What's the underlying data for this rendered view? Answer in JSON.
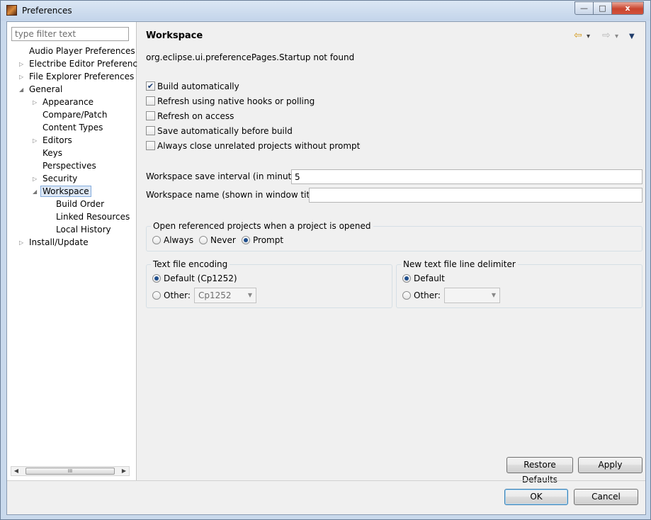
{
  "window": {
    "title": "Preferences",
    "buttons": {
      "minimize": "—",
      "maximize": "□",
      "close": "x"
    }
  },
  "filter": {
    "placeholder": "type filter text"
  },
  "tree": [
    {
      "label": "Audio Player Preferences",
      "level": 1,
      "twisty": ""
    },
    {
      "label": "Electribe Editor Preferences",
      "level": 1,
      "twisty": "collapsed"
    },
    {
      "label": "File Explorer Preferences",
      "level": 1,
      "twisty": "collapsed"
    },
    {
      "label": "General",
      "level": 1,
      "twisty": "expanded"
    },
    {
      "label": "Appearance",
      "level": 2,
      "twisty": "collapsed"
    },
    {
      "label": "Compare/Patch",
      "level": 2,
      "twisty": ""
    },
    {
      "label": "Content Types",
      "level": 2,
      "twisty": ""
    },
    {
      "label": "Editors",
      "level": 2,
      "twisty": "collapsed"
    },
    {
      "label": "Keys",
      "level": 2,
      "twisty": ""
    },
    {
      "label": "Perspectives",
      "level": 2,
      "twisty": ""
    },
    {
      "label": "Security",
      "level": 2,
      "twisty": "collapsed"
    },
    {
      "label": "Workspace",
      "level": 2,
      "twisty": "expanded",
      "selected": true
    },
    {
      "label": "Build Order",
      "level": 3,
      "twisty": ""
    },
    {
      "label": "Linked Resources",
      "level": 3,
      "twisty": ""
    },
    {
      "label": "Local History",
      "level": 3,
      "twisty": ""
    },
    {
      "label": "Install/Update",
      "level": 1,
      "twisty": "collapsed"
    }
  ],
  "scrollbar": {
    "thumb_grip": "III"
  },
  "page": {
    "title": "Workspace",
    "nav": {
      "back": "⇦",
      "back_menu": "▾",
      "forward": "⇨",
      "forward_menu": "▾",
      "view_menu": "▼"
    },
    "message": "org.eclipse.ui.preferencePages.Startup not found",
    "checkboxes": [
      {
        "label": "Build automatically",
        "checked": true
      },
      {
        "label": "Refresh using native hooks or polling",
        "checked": false
      },
      {
        "label": "Refresh on access",
        "checked": false
      },
      {
        "label": "Save automatically before build",
        "checked": false
      },
      {
        "label": "Always close unrelated projects without prompt",
        "checked": false
      }
    ],
    "save_interval_label": "Workspace save interval (in minutes):",
    "save_interval_value": "5",
    "workspace_name_label": "Workspace name (shown in window title):",
    "workspace_name_value": "",
    "open_ref": {
      "title": "Open referenced projects when a project is opened",
      "options": [
        {
          "label": "Always",
          "selected": false
        },
        {
          "label": "Never",
          "selected": false
        },
        {
          "label": "Prompt",
          "selected": true
        }
      ]
    },
    "encoding": {
      "title": "Text file encoding",
      "default_label": "Default (Cp1252)",
      "other_label": "Other:",
      "other_value": "Cp1252",
      "selected": "default"
    },
    "delimiter": {
      "title": "New text file line delimiter",
      "default_label": "Default",
      "other_label": "Other:",
      "other_value": "",
      "selected": "default"
    },
    "restore_defaults": "Restore Defaults",
    "apply": "Apply"
  },
  "footer": {
    "ok": "OK",
    "cancel": "Cancel"
  },
  "colors": {
    "selection_bg": "#dde8f6",
    "selection_border": "#84acdd",
    "radio_dot": "#1f4e8c",
    "close_button": "#c9452f"
  }
}
